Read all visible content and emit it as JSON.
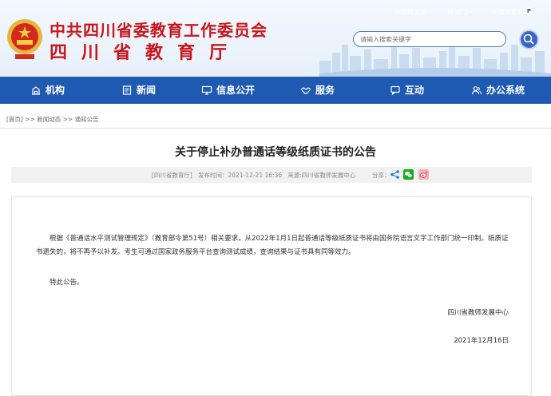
{
  "header": {
    "title_cn": "中共四川省委教育工作委员会",
    "title_sub": "四川省教育厅",
    "top_links": [
      "无障碍浏览",
      "移动门户",
      "新媒体矩阵"
    ],
    "search_placeholder": "请输入搜索关键字"
  },
  "nav": {
    "items": [
      {
        "label": "机构",
        "icon": "building-icon"
      },
      {
        "label": "新闻",
        "icon": "news-icon"
      },
      {
        "label": "信息公开",
        "icon": "monitor-icon"
      },
      {
        "label": "服务",
        "icon": "handshake-icon"
      },
      {
        "label": "互动",
        "icon": "chat-icon"
      },
      {
        "label": "办公系统",
        "icon": "user-group-icon"
      }
    ]
  },
  "breadcrumb": {
    "home": "[首页]",
    "sep": ">>",
    "level1": "新闻动态",
    "level2": "通知公告"
  },
  "article": {
    "title": "关于停止补办普通话等级纸质证书的公告",
    "source_tag": "[四川省教育厅]",
    "publish_label": "发布时间：",
    "publish_time": "2021-12-21 16:36",
    "origin_label": "来源:",
    "origin": "四川省教师发展中心",
    "share_label": "分享：",
    "paragraph1": "根据《普通话水平测试管理规定》（教育部令第51号）相关要求，从2022年1月1日起普通话等级纸质证书将由国务院语言文字工作部门统一印制。纸质证书遗失的，将不再予以补发。考生可通过国家政务服务平台查询测试成绩，查询结果与证书具有同等效力。",
    "paragraph2": "特此公告。",
    "signature": "四川省教师发展中心",
    "date": "2021年12月16日"
  },
  "colors": {
    "brand_red": "#c8161d",
    "nav_blue": "#1e5ab1",
    "wechat_green": "#1aad19",
    "weibo_red": "#e6162d"
  }
}
